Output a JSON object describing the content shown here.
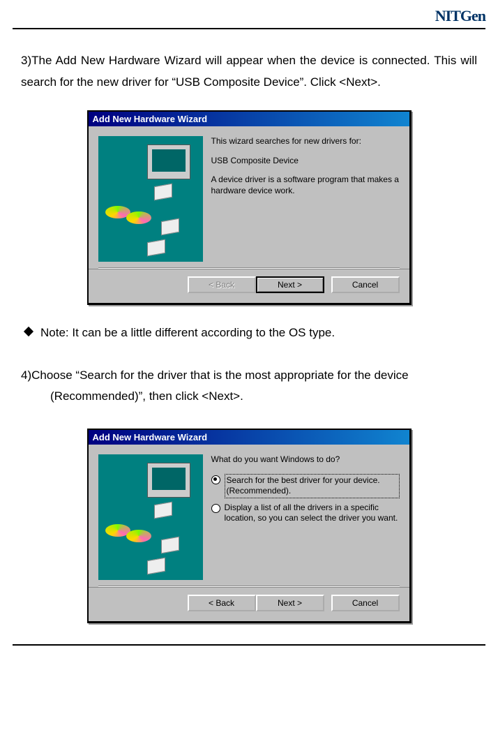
{
  "logo": "NITGen",
  "step3_text": "3)The Add New Hardware Wizard will appear when the device is connected. This will search for the new driver for  “USB Composite Device”. Click <Next>.",
  "note_text": "Note: It can be a little different according to the OS type.",
  "step4_line1": "4)Choose “Search for the driver that is the most appropriate for the device",
  "step4_line2": "(Recommended)”, then click <Next>.",
  "wizard1": {
    "title": "Add New Hardware Wizard",
    "line1": "This wizard searches for new drivers for:",
    "device": "USB Composite Device",
    "line2": "A device driver is a software program that makes a hardware device work.",
    "back": "< Back",
    "next": "Next >",
    "cancel": "Cancel"
  },
  "wizard2": {
    "title": "Add New Hardware Wizard",
    "question": "What do you want Windows to do?",
    "opt1": "Search for the best driver for your device. (Recommended).",
    "opt2": "Display a list of all the drivers in a specific location, so you can select the driver you want.",
    "back": "< Back",
    "next": "Next >",
    "cancel": "Cancel"
  }
}
